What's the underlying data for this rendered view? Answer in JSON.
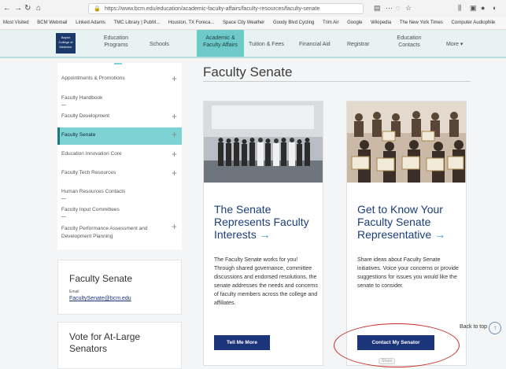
{
  "browser": {
    "url": "https://www.bcm.edu/education/academic-faculty-affairs/faculty-resources/faculty-senate",
    "bookmarks": [
      "Most Visited",
      "BCM Webmail",
      "Linked Adams",
      "TMC Library | PubM...",
      "Houston, TX Foreca...",
      "Space City Weather",
      "Goody Blvd Cycling",
      "Trim Air",
      "Google",
      "Wikipedia",
      "The New York Times",
      "Computer Audiophile"
    ]
  },
  "site_nav": {
    "logo_text": "Baylor College of Medicine",
    "items": [
      {
        "label": "Education\nPrograms"
      },
      {
        "label": "Schools"
      },
      {
        "label": "Academic &\nFaculty Affairs"
      },
      {
        "label": "Tuition & Fees"
      },
      {
        "label": "Financial Aid"
      },
      {
        "label": "Registrar"
      },
      {
        "label": "Education\nContacts"
      },
      {
        "label": "More ▾"
      }
    ]
  },
  "sidebar": {
    "items": [
      {
        "label": "Appointments & Promotions",
        "expandable": true
      },
      {
        "label": "Faculty Handbook",
        "expandable": false
      },
      {
        "label": "Faculty Development",
        "expandable": true
      },
      {
        "label": "Faculty Senate",
        "expandable": true,
        "active": true
      },
      {
        "label": "Education Innovation Core",
        "expandable": true
      },
      {
        "label": "Faculty Tech Resources",
        "expandable": true
      },
      {
        "label": "Human Resources Contacts",
        "expandable": false
      },
      {
        "label": "Faculty Input Committees",
        "expandable": false
      },
      {
        "label": "Faculty Performance Assessment and Development Planning",
        "expandable": true
      }
    ],
    "contact_box": {
      "title": "Faculty Senate",
      "email_label": "Email",
      "email": "FacultySenate@bcm.edu"
    },
    "vote_box": {
      "title": "Vote for At-Large Senators"
    }
  },
  "main": {
    "page_title": "Faculty Senate",
    "cards": [
      {
        "title": "The Senate Represents Faculty Interests",
        "body": "The Faculty Senate works for you! Through shared governance, committee discussions and endorsed resolutions, the senate addresses the needs and concerns of faculty members across the college and affiliates.",
        "button": "Tell Me More"
      },
      {
        "title": "Get to Know Your Faculty Senate Representative",
        "body": "Share ideas about Faculty Senate initiatives. Voice your concerns or provide suggestions for issues you would like the senate to consider.",
        "button": "Contact My Senator"
      }
    ]
  },
  "back_to_top": "Back to top",
  "pill_text": "Share",
  "colors": {
    "nav_active": "#6ec9c9",
    "sidebar_active": "#7dd3d3",
    "button": "#1c3479",
    "card_title": "#1b3e7a",
    "annotation": "#c62a2a"
  }
}
